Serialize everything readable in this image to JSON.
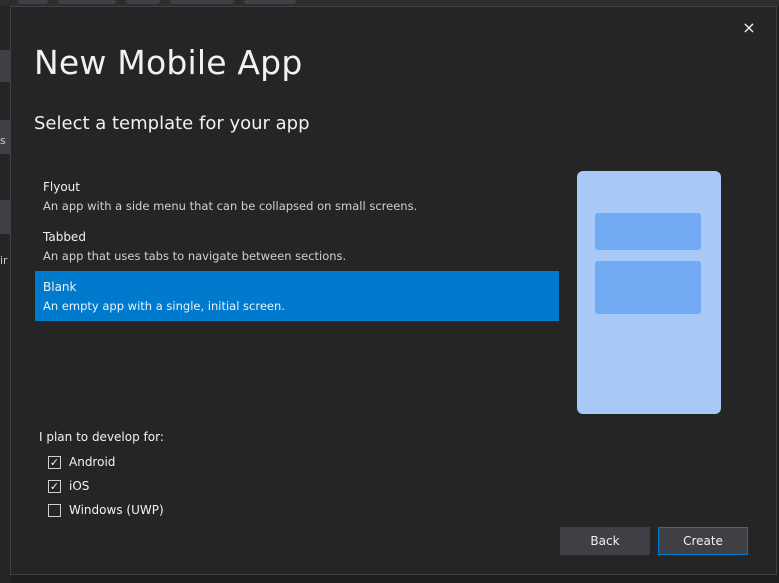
{
  "dialog": {
    "title": "New Mobile App",
    "subtitle": "Select a template for your app",
    "close_icon": "×"
  },
  "templates": [
    {
      "name": "Flyout",
      "description": "An app with a side menu that can be collapsed on small screens.",
      "selected": false
    },
    {
      "name": "Tabbed",
      "description": "An app that uses tabs to navigate between sections.",
      "selected": false
    },
    {
      "name": "Blank",
      "description": "An empty app with a single, initial screen.",
      "selected": true
    }
  ],
  "platforms": {
    "label": "I plan to develop for:",
    "items": [
      {
        "label": "Android",
        "checked": true
      },
      {
        "label": "iOS",
        "checked": true
      },
      {
        "label": "Windows (UWP)",
        "checked": false
      }
    ]
  },
  "buttons": {
    "back": "Back",
    "create": "Create"
  },
  "background": {
    "left_glyph_1": "s",
    "left_glyph_2": "ir"
  },
  "colors": {
    "accent": "#007acc",
    "dialog_bg": "#252526",
    "preview_bg": "#a8c8f7",
    "preview_block": "#71a9f2"
  }
}
